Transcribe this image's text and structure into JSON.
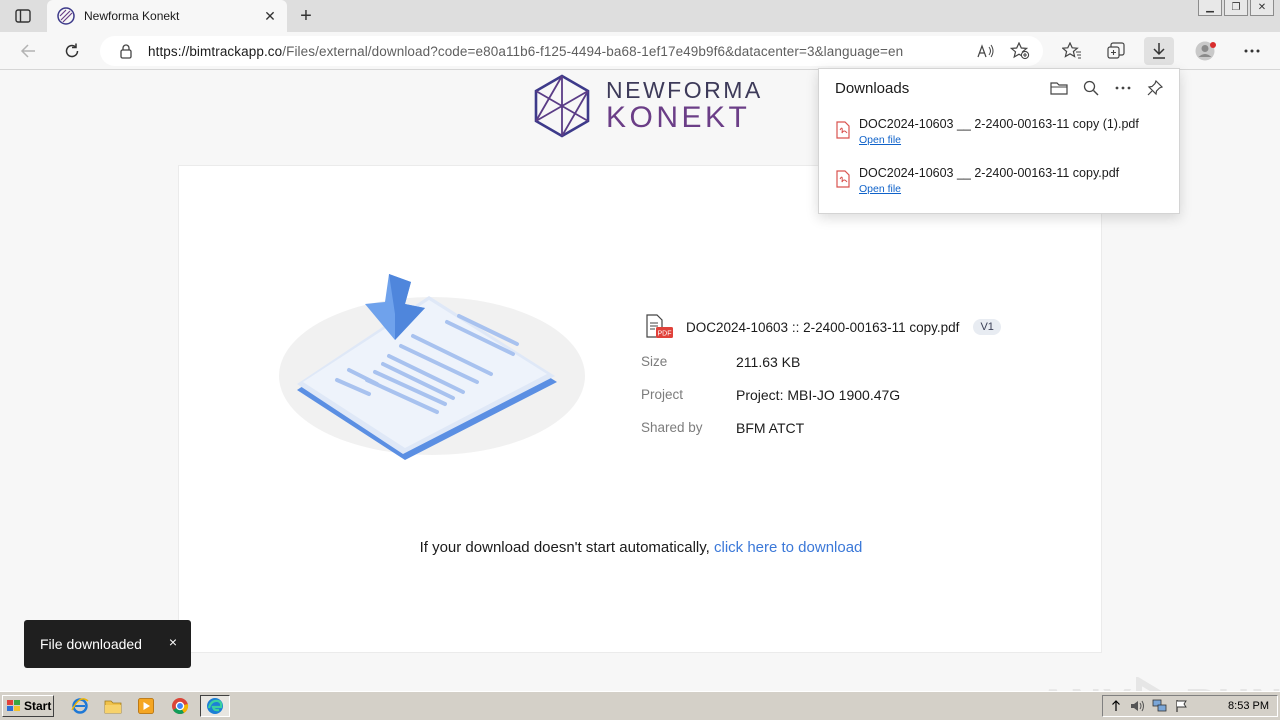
{
  "browser": {
    "tab_title": "Newforma Konekt",
    "url_domain": "https://bimtrackapp.co",
    "url_path": "/Files/external/download?code=e80a11b6-f125-4494-ba68-1ef17e49b9f6&datacenter=3&language=en",
    "read_aloud_glyph": "A̅"
  },
  "page": {
    "logo_line1": "NEWFORMA",
    "logo_line2": "KONEKT",
    "file_name": "DOC2024-10603 :: 2-2400-00163-11 copy.pdf",
    "version": "V1",
    "size_label": "Size",
    "size_value": "211.63 KB",
    "project_label": "Project",
    "project_value": "Project: MBI-JO 1900.47G",
    "shared_label": "Shared by",
    "shared_value": "BFM ATCT",
    "download_text": "If your download doesn't start automatically, ",
    "download_link_text": "click here to download",
    "accent_color": "#3b78d8"
  },
  "toast": {
    "text": "File downloaded",
    "close": "×"
  },
  "downloads_panel": {
    "title": "Downloads",
    "items": [
      {
        "name": "DOC2024-10603 __ 2-2400-00163-11 copy (1).pdf",
        "action": "Open file"
      },
      {
        "name": "DOC2024-10603 __ 2-2400-00163-11 copy.pdf",
        "action": "Open file"
      }
    ]
  },
  "watermark": {
    "left": "ANY",
    "right": "RUN"
  },
  "taskbar": {
    "start_label": "Start",
    "clock": "8:53 PM"
  }
}
